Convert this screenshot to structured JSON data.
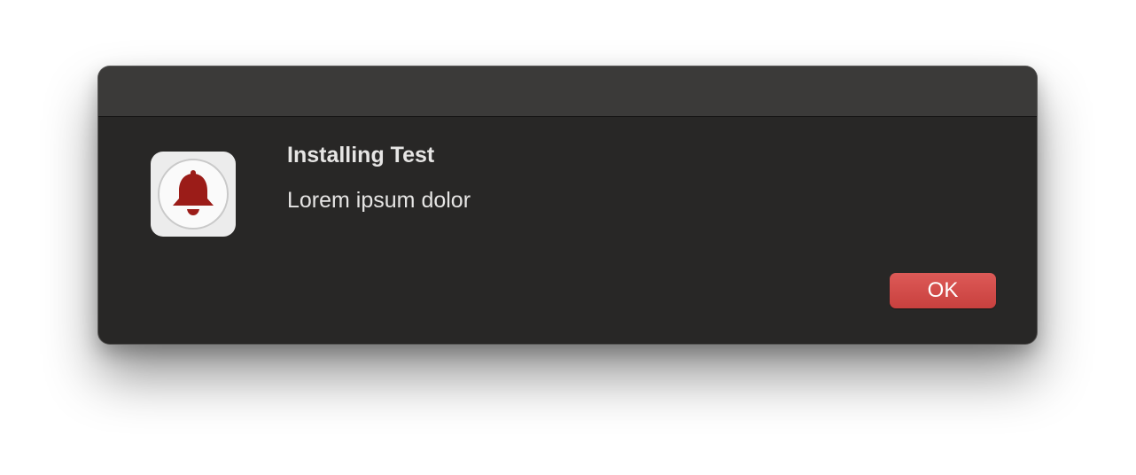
{
  "dialog": {
    "title": "Installing Test",
    "message": "Lorem ipsum dolor",
    "ok_label": "OK",
    "icon": "bell-icon"
  },
  "colors": {
    "window_background": "#282726",
    "titlebar_background": "#3b3a39",
    "accent_button": "#d44e4b",
    "bell": "#9b1c18"
  }
}
